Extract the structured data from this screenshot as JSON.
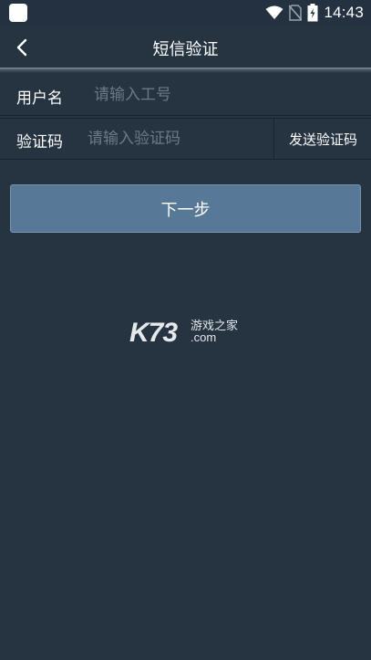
{
  "status_bar": {
    "time": "14:43",
    "icons": [
      "app-icon",
      "wifi-icon",
      "no-sim-icon",
      "battery-charging-icon"
    ]
  },
  "header": {
    "title": "短信验证",
    "back_icon": "chevron-left-icon"
  },
  "form": {
    "username": {
      "label": "用户名",
      "value": "",
      "placeholder": "请输入工号"
    },
    "code": {
      "label": "验证码",
      "value": "",
      "placeholder": "请输入验证码",
      "send_button_label": "发送验证码"
    }
  },
  "actions": {
    "next_label": "下一步"
  },
  "watermark": {
    "brand": "K73",
    "tagline": "游戏之家",
    "domain": ".com"
  },
  "colors": {
    "background": "#263341",
    "button": "#587897",
    "placeholder": "#6d7985"
  }
}
